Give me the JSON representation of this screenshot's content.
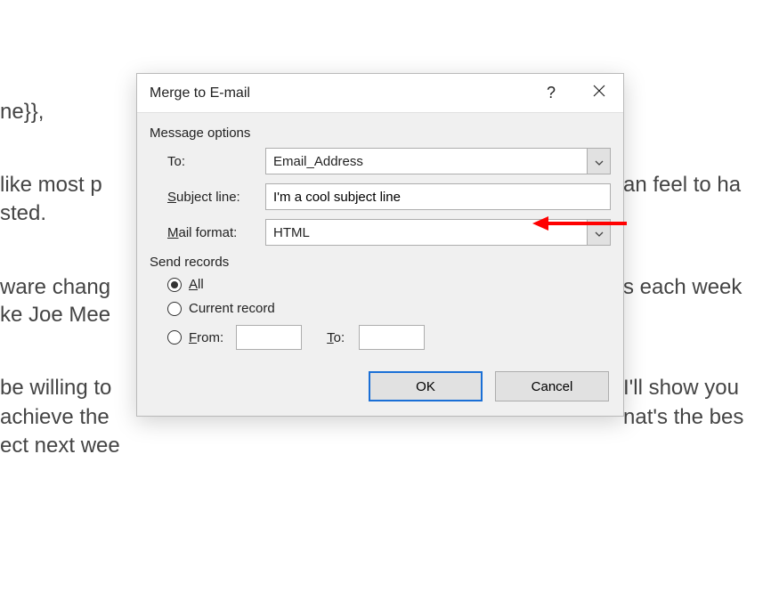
{
  "background": {
    "line1": "ne}},",
    "line2_left": " like most p",
    "line2_right": "an feel to ha",
    "line3": "sted.",
    "line4_left": "ware chang",
    "line4_right": "s each week",
    "line5": "ke Joe Mee",
    "line6_left": "be willing to",
    "line6_right": "I'll show you",
    "line7_left": " achieve the",
    "line7_right": "nat's the bes",
    "line8": "ect next wee"
  },
  "dialog": {
    "title": "Merge to E-mail",
    "group_message": "Message options",
    "to_label": "To:",
    "to_value": "Email_Address",
    "subject_label_pre": "S",
    "subject_label_rest": "ubject line:",
    "subject_value": "I'm a cool subject line",
    "mail_label_pre": "M",
    "mail_label_rest": "ail format:",
    "mail_value": "HTML",
    "group_send": "Send records",
    "radio_all_pre": "A",
    "radio_all_rest": "ll",
    "radio_current": "Current record",
    "radio_from_pre": "F",
    "radio_from_rest": "rom:",
    "range_to_pre": "T",
    "range_to_rest": "o:",
    "ok": "OK",
    "cancel": "Cancel",
    "help": "?"
  }
}
